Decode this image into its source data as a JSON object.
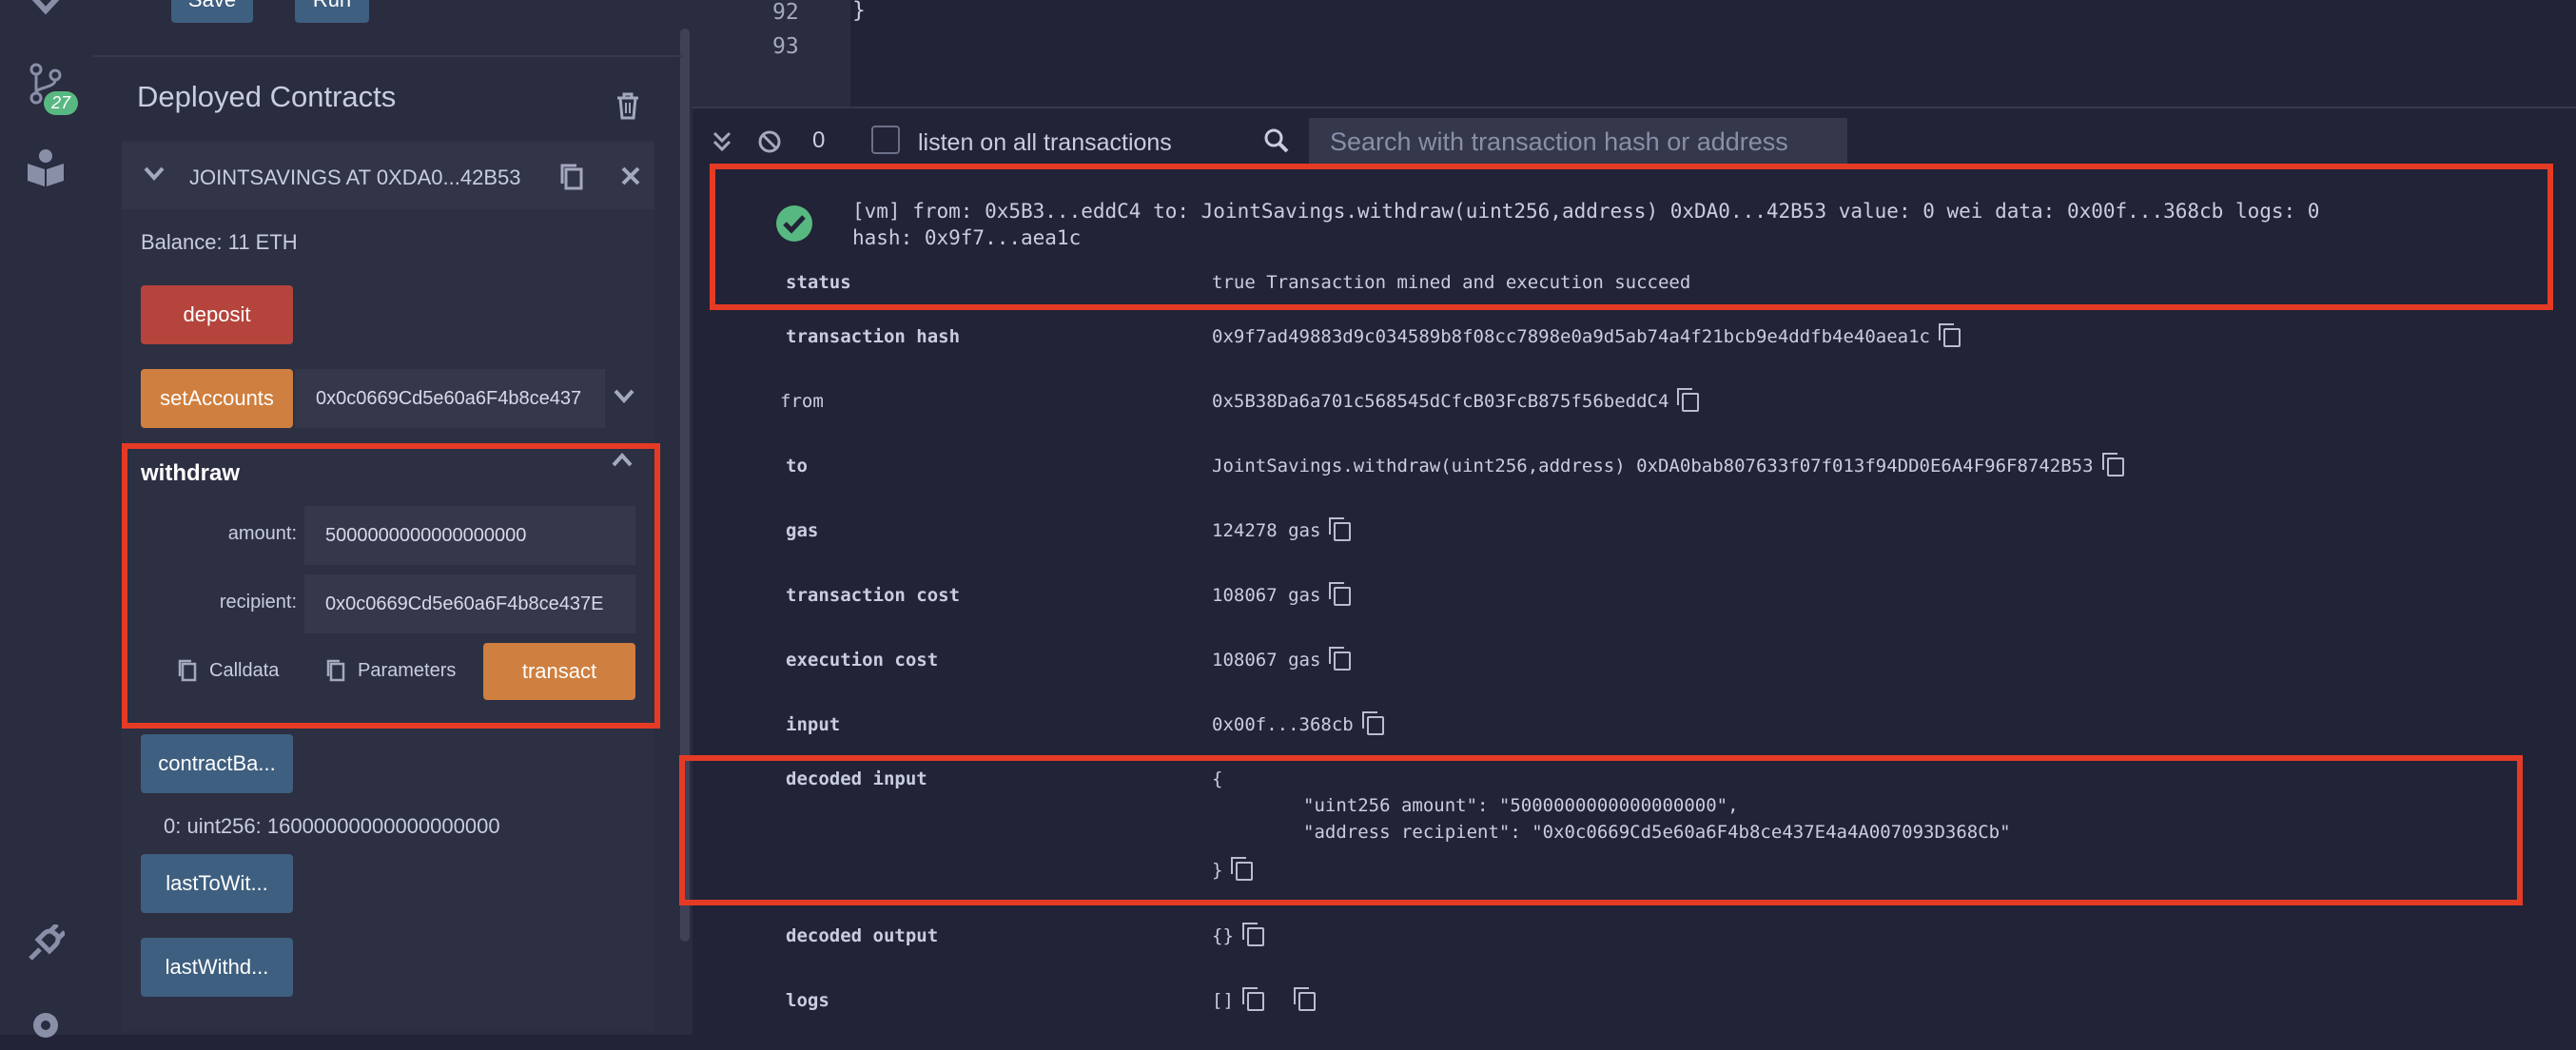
{
  "toolbar": {
    "save_label": "Save",
    "run_label": "Run"
  },
  "sidebar": {
    "git_badge": "27"
  },
  "deployed": {
    "title": "Deployed Contracts",
    "instance_label": "JOINTSAVINGS AT 0XDA0...42B53",
    "balance": "Balance: 11 ETH",
    "deposit_label": "deposit",
    "set_accounts_label": "setAccounts",
    "set_accounts_value": "0x0c0669Cd5e60a6F4b8ce437",
    "withdraw": {
      "title": "withdraw",
      "amount_label": "amount:",
      "amount_value": "5000000000000000000",
      "recipient_label": "recipient:",
      "recipient_value": "0x0c0669Cd5e60a6F4b8ce437E",
      "calldata_label": "Calldata",
      "parameters_label": "Parameters",
      "transact_label": "transact"
    },
    "contract_balance_label": "contractBa...",
    "contract_balance_result": "0: uint256: 16000000000000000000",
    "last_to_withdraw_label": "lastToWit...",
    "last_withdraw_label": "lastWithd..."
  },
  "editor": {
    "line_92": "92",
    "line_93": "93",
    "brace": "}"
  },
  "terminal": {
    "pending_count": "0",
    "listen_label": "listen on all transactions",
    "search_placeholder": "Search with transaction hash or address",
    "tx_summary_line1": "[vm] from: 0x5B3...eddC4 to: JointSavings.withdraw(uint256,address) 0xDA0...42B53 value: 0 wei data: 0x00f...368cb logs: 0",
    "tx_summary_line2": "hash: 0x9f7...aea1c",
    "rows": {
      "status_key": "status",
      "status_val": "true Transaction mined and execution succeed",
      "hash_key": "transaction hash",
      "hash_val": "0x9f7ad49883d9c034589b8f08cc7898e0a9d5ab74a4f21bcb9e4ddfb4e40aea1c",
      "from_key": "from",
      "from_val": "0x5B38Da6a701c568545dCfcB03FcB875f56beddC4",
      "to_key": "to",
      "to_val": "JointSavings.withdraw(uint256,address) 0xDA0bab807633f07f013f94DD0E6A4F96F8742B53",
      "gas_key": "gas",
      "gas_val": "124278 gas",
      "txcost_key": "transaction cost",
      "txcost_val": "108067 gas",
      "execcost_key": "execution cost",
      "execcost_val": "108067 gas",
      "input_key": "input",
      "input_val": "0x00f...368cb",
      "decoded_input_key": "decoded input",
      "decoded_input_open": "{",
      "decoded_input_line1": "\"uint256 amount\": \"5000000000000000000\",",
      "decoded_input_line2": "\"address recipient\": \"0x0c0669Cd5e60a6F4b8ce437E4a4A007093D368Cb\"",
      "decoded_input_close": "}",
      "decoded_output_key": "decoded output",
      "decoded_output_val": "{}",
      "logs_key": "logs",
      "logs_val": "[]"
    }
  }
}
